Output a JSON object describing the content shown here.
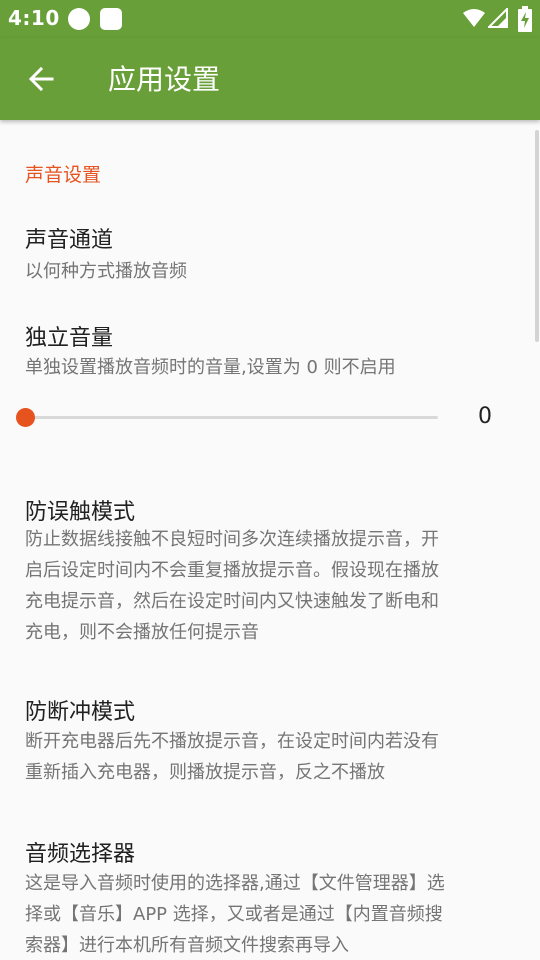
{
  "status_bar": {
    "time": "4:10"
  },
  "app_bar": {
    "title": "应用设置",
    "back_icon": "arrow-left-icon"
  },
  "colors": {
    "primary": "#689f38",
    "accent": "#e6531f"
  },
  "section": {
    "header": "声音设置"
  },
  "prefs": {
    "sound_channel": {
      "title": "声音通道",
      "summary": "以何种方式播放音频"
    },
    "independent_volume": {
      "title": "独立音量",
      "summary": "单独设置播放音频时的音量,设置为 0 则不启用",
      "value": 0,
      "value_label": "0"
    },
    "anti_false_touch": {
      "title": "防误触模式",
      "summary_lines": [
        "防止数据线接触不良短时间多次连续播放提示音，开",
        "启后设定时间内不会重复播放提示音。假设现在播放",
        "充电提示音，然后在设定时间内又快速触发了断电和",
        "充电，则不会播放任何提示音"
      ]
    },
    "anti_disconnect": {
      "title": "防断冲模式",
      "summary_lines": [
        "断开充电器后先不播放提示音，在设定时间内若没有",
        "重新插入充电器，则播放提示音，反之不播放"
      ]
    },
    "audio_picker": {
      "title": "音频选择器",
      "summary_lines": [
        "这是导入音频时使用的选择器,通过【文件管理器】选",
        "择或【音乐】APP 选择，又或者是通过【内置音频搜",
        "索器】进行本机所有音频文件搜索再导入"
      ]
    }
  }
}
